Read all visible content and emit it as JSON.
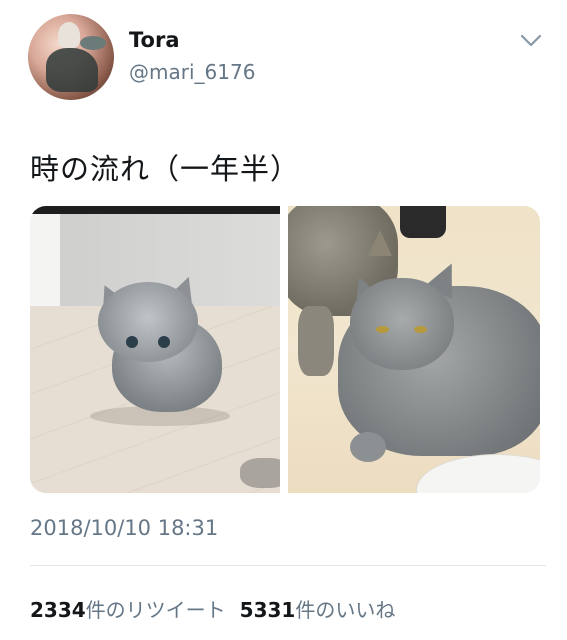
{
  "user": {
    "display_name": "Tora",
    "handle": "@mari_6176",
    "avatar_icon": "avatar-image"
  },
  "tweet": {
    "text": "時の流れ（一年半）",
    "timestamp": "2018/10/10 18:31",
    "media": [
      {
        "name": "kitten-photo"
      },
      {
        "name": "grown-cat-photo"
      }
    ]
  },
  "stats": {
    "retweets_count": "2334",
    "retweets_label": "件のリツイート",
    "likes_count": "5331",
    "likes_label": "件のいいね"
  },
  "icons": {
    "menu": "chevron-down-icon"
  },
  "colors": {
    "primary_text": "#14171a",
    "secondary_text": "#657786",
    "divider": "#e1e8ed"
  }
}
